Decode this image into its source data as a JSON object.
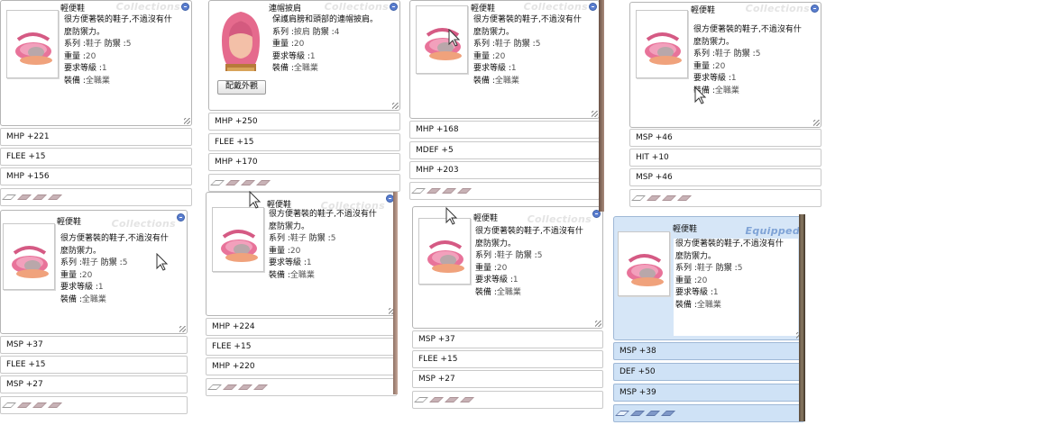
{
  "watermark": "Collections",
  "equipped_label": "Equipped",
  "show_costume_label": "配戴外觀",
  "labels": {
    "series": "系列 :",
    "defense": "防禦 :",
    "weight": "重量 :",
    "req_level": "要求等級 :",
    "equip": "裝備 :"
  },
  "cards": [
    {
      "name": "輕便鞋",
      "desc1": "很方便著裝的鞋子,不過沒有什",
      "desc2": "麼防禦力。",
      "series": "鞋子",
      "defense": "5",
      "weight": "20",
      "req_level": "1",
      "equip": "全職業",
      "stats": [
        "MHP +221",
        "FLEE +15",
        "MHP +156"
      ]
    },
    {
      "name": "連帽披肩",
      "desc1": "保護肩膀和頭部的連帽披肩。",
      "series": "披肩",
      "defense": "4",
      "weight": "20",
      "req_level": "1",
      "equip": "全職業",
      "stats": [
        "MHP +250",
        "FLEE +15",
        "MHP +170"
      ]
    },
    {
      "name": "輕便鞋",
      "desc1": "很方便著裝的鞋子,不過沒有什",
      "desc2": "麼防禦力。",
      "series": "鞋子",
      "defense": "5",
      "weight": "20",
      "req_level": "1",
      "equip": "全職業",
      "stats": [
        "MHP +168",
        "MDEF +5",
        "MHP +203"
      ]
    },
    {
      "name": "輕便鞋",
      "desc1": "很方便著裝的鞋子,不過沒有什",
      "desc2": "麼防禦力。",
      "series": "鞋子",
      "defense": "5",
      "weight": "20",
      "req_level": "1",
      "equip": "全職業",
      "stats": [
        "MSP +46",
        "HIT +10",
        "MSP +46"
      ]
    },
    {
      "name": "輕便鞋",
      "desc1": "很方便著裝的鞋子,不過沒有什",
      "desc2": "麼防禦力。",
      "series": "鞋子",
      "defense": "5",
      "weight": "20",
      "req_level": "1",
      "equip": "全職業",
      "stats": [
        "MSP +37",
        "FLEE +15",
        "MSP +27"
      ]
    },
    {
      "name": "輕便鞋",
      "desc1": "很方便著裝的鞋子,不過沒有什",
      "desc2": "麼防禦力。",
      "series": "鞋子",
      "defense": "5",
      "weight": "20",
      "req_level": "1",
      "equip": "全職業",
      "stats": [
        "MHP +224",
        "FLEE +15",
        "MHP +220"
      ]
    },
    {
      "name": "輕便鞋",
      "desc1": "很方便著裝的鞋子,不過沒有什",
      "desc2": "麼防禦力。",
      "series": "鞋子",
      "defense": "5",
      "weight": "20",
      "req_level": "1",
      "equip": "全職業",
      "stats": [
        "MSP +37",
        "FLEE +15",
        "MSP +27"
      ]
    },
    {
      "name": "輕便鞋",
      "desc1": "很方便著裝的鞋子,不過沒有什",
      "desc2": "麼防禦力。",
      "series": "鞋子",
      "defense": "5",
      "weight": "20",
      "req_level": "1",
      "equip": "全職業",
      "stats": [
        "MSP +38",
        "DEF +50",
        "MSP +39"
      ]
    }
  ],
  "colors": {
    "card_border": "#b5b5b5",
    "equipped_bg": "#d6e6f7",
    "equipped_text": "#7fa3d6",
    "watermark": "#e4e4e4",
    "shoe_pink": "#e8739a"
  },
  "icons": [
    "shoe-icon",
    "hood-icon",
    "close-icon",
    "cursor-icon",
    "slot-gem-icon"
  ]
}
